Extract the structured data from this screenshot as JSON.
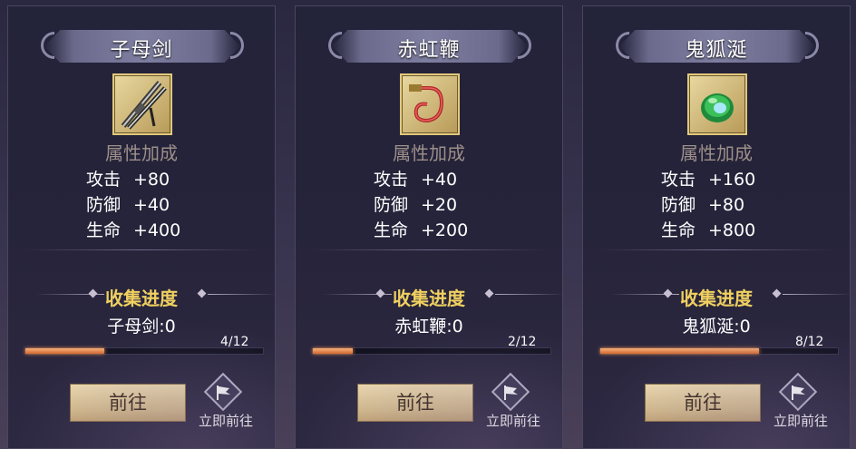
{
  "cards": [
    {
      "title": "子母剑",
      "icon": "twin-sword-icon",
      "attr_heading": "属性加成",
      "stats": [
        {
          "key": "攻击",
          "value": "+80"
        },
        {
          "key": "防御",
          "value": "+40"
        },
        {
          "key": "生命",
          "value": "+400"
        }
      ],
      "progress_heading": "收集进度",
      "collected": "子母剑:0",
      "count": "4/12",
      "progress_fraction": 0.333,
      "go_label": "前往",
      "quick_label": "立即前往"
    },
    {
      "title": "赤虹鞭",
      "icon": "red-whip-icon",
      "attr_heading": "属性加成",
      "stats": [
        {
          "key": "攻击",
          "value": "+40"
        },
        {
          "key": "防御",
          "value": "+20"
        },
        {
          "key": "生命",
          "value": "+200"
        }
      ],
      "progress_heading": "收集进度",
      "collected": "赤虹鞭:0",
      "count": "2/12",
      "progress_fraction": 0.167,
      "go_label": "前往",
      "quick_label": "立即前往"
    },
    {
      "title": "鬼狐涎",
      "icon": "green-orb-icon",
      "attr_heading": "属性加成",
      "stats": [
        {
          "key": "攻击",
          "value": "+160"
        },
        {
          "key": "防御",
          "value": "+80"
        },
        {
          "key": "生命",
          "value": "+800"
        }
      ],
      "progress_heading": "收集进度",
      "collected": "鬼狐涎:0",
      "count": "8/12",
      "progress_fraction": 0.667,
      "go_label": "前往",
      "quick_label": "立即前往"
    }
  ],
  "colors": {
    "title": "#ffffff",
    "attr_heading": "#9c8f8a",
    "progress_heading": "#f0d060",
    "progress_fill": "#e07a40",
    "button_bg": "#e4cc9c",
    "button_text": "#3b2a1c"
  }
}
